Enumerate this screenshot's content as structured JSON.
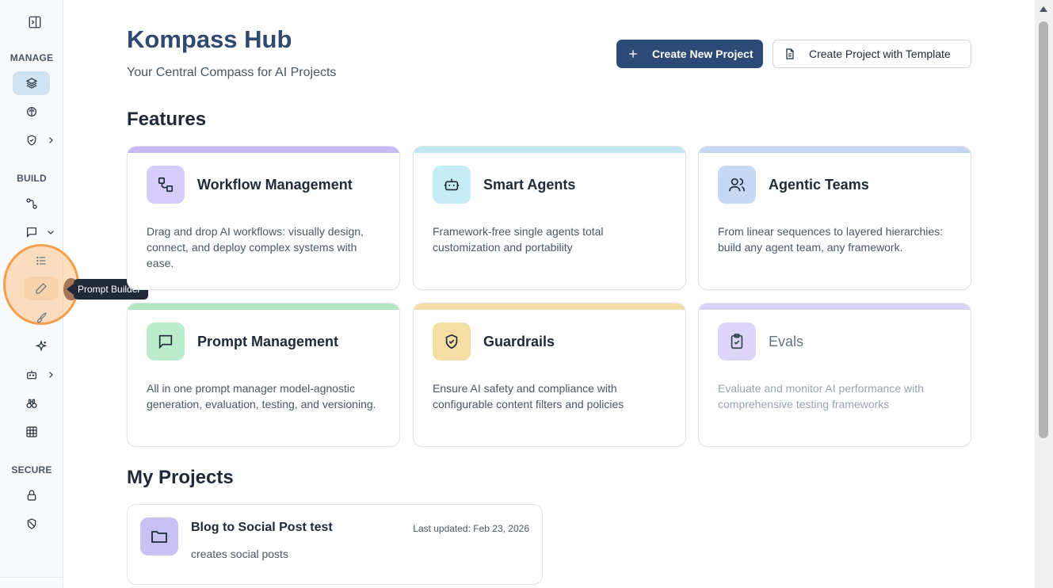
{
  "header": {
    "title": "Kompass Hub",
    "subtitle": "Your Central Compass for AI Projects",
    "create_project_label": "Create New Project",
    "create_template_label": "Create Project with Template"
  },
  "sidebar": {
    "sections": {
      "manage": "MANAGE",
      "build": "BUILD",
      "secure": "SECURE"
    },
    "tooltip": "Prompt Builder"
  },
  "features": {
    "heading": "Features",
    "cards": [
      {
        "title": "Workflow Management",
        "description": "Drag and drop AI workflows: visually design, connect, and deploy complex systems with ease.",
        "icon": "workflow-icon",
        "accent": "#c6b9f5"
      },
      {
        "title": "Smart Agents",
        "description": "Framework-free single agents total customization and portability",
        "icon": "bot-icon",
        "accent": "#bfe8f3"
      },
      {
        "title": "Agentic Teams",
        "description": "From linear sequences to layered hierarchies: build any agent team, any framework.",
        "icon": "users-icon",
        "accent": "#c4d6f1"
      },
      {
        "title": "Prompt Management",
        "description": "All in one prompt manager model-agnostic generation, evaluation, testing, and versioning.",
        "icon": "message-square-icon",
        "accent": "#b4e6c6"
      },
      {
        "title": "Guardrails",
        "description": "Ensure AI safety and compliance with configurable content filters and policies",
        "icon": "shield-check-icon",
        "accent": "#f3dca6"
      },
      {
        "title": "Evals",
        "description": "Evaluate and monitor AI performance with comprehensive testing frameworks",
        "icon": "clipboard-check-icon",
        "accent": "#d9d1f7"
      }
    ]
  },
  "projects": {
    "heading": "My Projects",
    "items": [
      {
        "name": "Blog to Social Post test",
        "description": "creates social posts",
        "updated": "Last updated: Feb 23, 2026"
      }
    ]
  },
  "colors": {
    "brand": "#2c4a75",
    "title": "#2e4a6f",
    "active_nav": "#cfe3f3",
    "highlight": "#f59e4b"
  }
}
